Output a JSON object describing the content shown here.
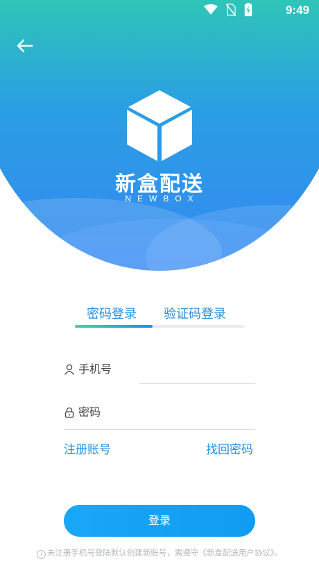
{
  "status_bar": {
    "time": "9:49",
    "icons": [
      "wifi-icon",
      "no-sim-icon",
      "battery-charging-icon"
    ]
  },
  "header": {
    "back_icon": "arrow-left-icon",
    "logo_icon": "box-icon",
    "brand_title": "新盒配送",
    "brand_subtitle": "NEWBOX"
  },
  "colors": {
    "gradient_top": "#3bdc9b",
    "gradient_bottom": "#3588f2",
    "accent": "#1f8fe0",
    "button": "#12a0f4"
  },
  "tabs": [
    {
      "label": "密码登录",
      "active": true
    },
    {
      "label": "验证码登录",
      "active": false
    }
  ],
  "form": {
    "phone": {
      "placeholder": "手机号",
      "value": "",
      "icon": "user-icon"
    },
    "password": {
      "placeholder": "密码",
      "value": "",
      "icon": "lock-icon"
    }
  },
  "links": {
    "register": "注册账号",
    "forgot": "找回密码"
  },
  "login_button": "登录",
  "notice": {
    "icon": "info-icon",
    "text": "未注册手机号登陆默认创建新账号，需遵守《新盒配送用户协议》。"
  }
}
